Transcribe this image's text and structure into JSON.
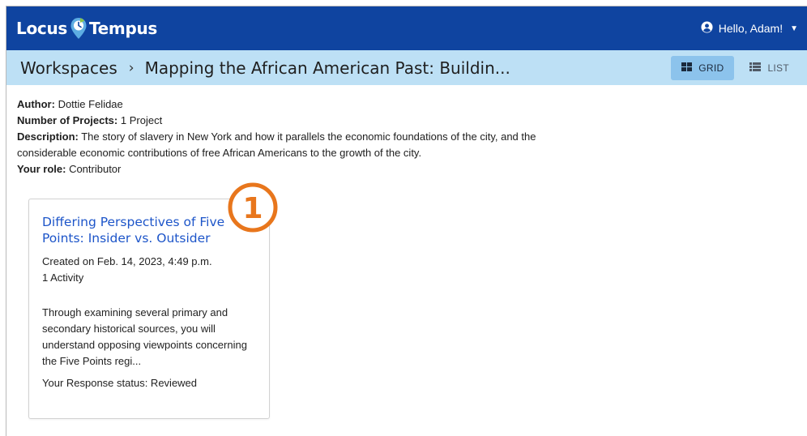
{
  "header": {
    "logo_left": "Locus",
    "logo_right": "Tempus",
    "user_greeting": "Hello, Adam!"
  },
  "breadcrumb": {
    "root": "Workspaces",
    "current": "Mapping the African American Past: Buildin..."
  },
  "view_toggle": {
    "grid_label": "GRID",
    "list_label": "LIST",
    "selected": "grid"
  },
  "workspace": {
    "author_label": "Author:",
    "author": "Dottie Felidae",
    "projects_label": "Number of Projects:",
    "projects": "1 Project",
    "description_label": "Description:",
    "description": "The story of slavery in New York and how it parallels the economic foundations of the city, and the considerable economic contributions of free African Americans to the growth of the city.",
    "role_label": "Your role:",
    "role": "Contributor"
  },
  "project_card": {
    "title": "Differing Perspectives of Five Points: Insider vs. Outsider",
    "created": "Created on Feb. 14, 2023, 4:49 p.m.",
    "activities": "1 Activity",
    "description": "Through examining several primary and secondary historical sources, you will understand opposing viewpoints concerning the Five Points regi...",
    "response_status": "Your Response status: Reviewed"
  },
  "callout": {
    "number": "1",
    "color": "#e8761c"
  },
  "colors": {
    "header_bg": "#0f44a0",
    "subbar_bg": "#bde0f5",
    "active_toggle": "#8cc3ec",
    "link": "#1d55c9"
  }
}
